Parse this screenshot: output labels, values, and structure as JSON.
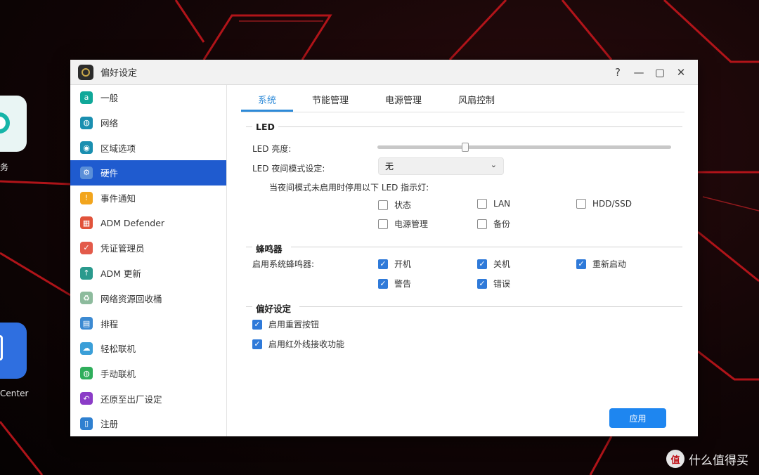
{
  "desktop": {
    "icon_labels": [
      "务",
      "Center"
    ],
    "watermark_logo": "值",
    "watermark_text": "什么值得买"
  },
  "window": {
    "title": "偏好设定",
    "controls": {
      "help": "?",
      "minimize": "—",
      "maximize": "▢",
      "close": "✕"
    }
  },
  "sidebar": {
    "items": [
      {
        "label": "一般",
        "icon": "general-icon",
        "color": "#10a899"
      },
      {
        "label": "网络",
        "icon": "globe-icon",
        "color": "#1a8fb0"
      },
      {
        "label": "区域选项",
        "icon": "region-icon",
        "color": "#1a8fb0"
      },
      {
        "label": "硬件",
        "icon": "hardware-icon",
        "color": "#5b8fd8",
        "active": true
      },
      {
        "label": "事件通知",
        "icon": "notification-icon",
        "color": "#f2a51d"
      },
      {
        "label": "ADM Defender",
        "icon": "firewall-icon",
        "color": "#e1533b"
      },
      {
        "label": "凭证管理员",
        "icon": "certificate-icon",
        "color": "#e35a4a"
      },
      {
        "label": "ADM 更新",
        "icon": "update-icon",
        "color": "#2a9a8d"
      },
      {
        "label": "网络资源回收桶",
        "icon": "recycle-bin-icon",
        "color": "#8dbb9d"
      },
      {
        "label": "排程",
        "icon": "schedule-icon",
        "color": "#3c8ad2"
      },
      {
        "label": "轻松联机",
        "icon": "cloud-connect-icon",
        "color": "#3b9fd8"
      },
      {
        "label": "手动联机",
        "icon": "manual-connect-icon",
        "color": "#2fae5b"
      },
      {
        "label": "还原至出厂设定",
        "icon": "restore-icon",
        "color": "#8b3cc7"
      },
      {
        "label": "注册",
        "icon": "register-icon",
        "color": "#2f80d0"
      }
    ]
  },
  "tabs": [
    {
      "label": "系统",
      "active": true
    },
    {
      "label": "节能管理"
    },
    {
      "label": "电源管理"
    },
    {
      "label": "风扇控制"
    }
  ],
  "led": {
    "section_title": "LED",
    "brightness_label": "LED 亮度:",
    "brightness_level": 0.3,
    "night_mode_label": "LED 夜间模式设定:",
    "night_mode_value": "无",
    "night_mode_hint": "当夜间模式未启用时停用以下 LED 指示灯:",
    "indicators": [
      {
        "label": "状态",
        "checked": false
      },
      {
        "label": "LAN",
        "checked": false
      },
      {
        "label": "HDD/SSD",
        "checked": false
      },
      {
        "label": "电源管理",
        "checked": false
      },
      {
        "label": "备份",
        "checked": false
      }
    ]
  },
  "buzzer": {
    "section_title": "蜂鸣器",
    "enable_label": "启用系统蜂鸣器:",
    "options": [
      {
        "label": "开机",
        "checked": true
      },
      {
        "label": "关机",
        "checked": true
      },
      {
        "label": "重新启动",
        "checked": true
      },
      {
        "label": "警告",
        "checked": true
      },
      {
        "label": "错误",
        "checked": true
      }
    ]
  },
  "preferences": {
    "section_title": "偏好设定",
    "options": [
      {
        "label": "启用重置按钮",
        "checked": true
      },
      {
        "label": "启用红外线接收功能",
        "checked": true
      }
    ]
  },
  "apply_label": "应用",
  "colors": {
    "accent": "#1f5bcf",
    "tab_active": "#2d8ad8",
    "button": "#1e86f0"
  }
}
